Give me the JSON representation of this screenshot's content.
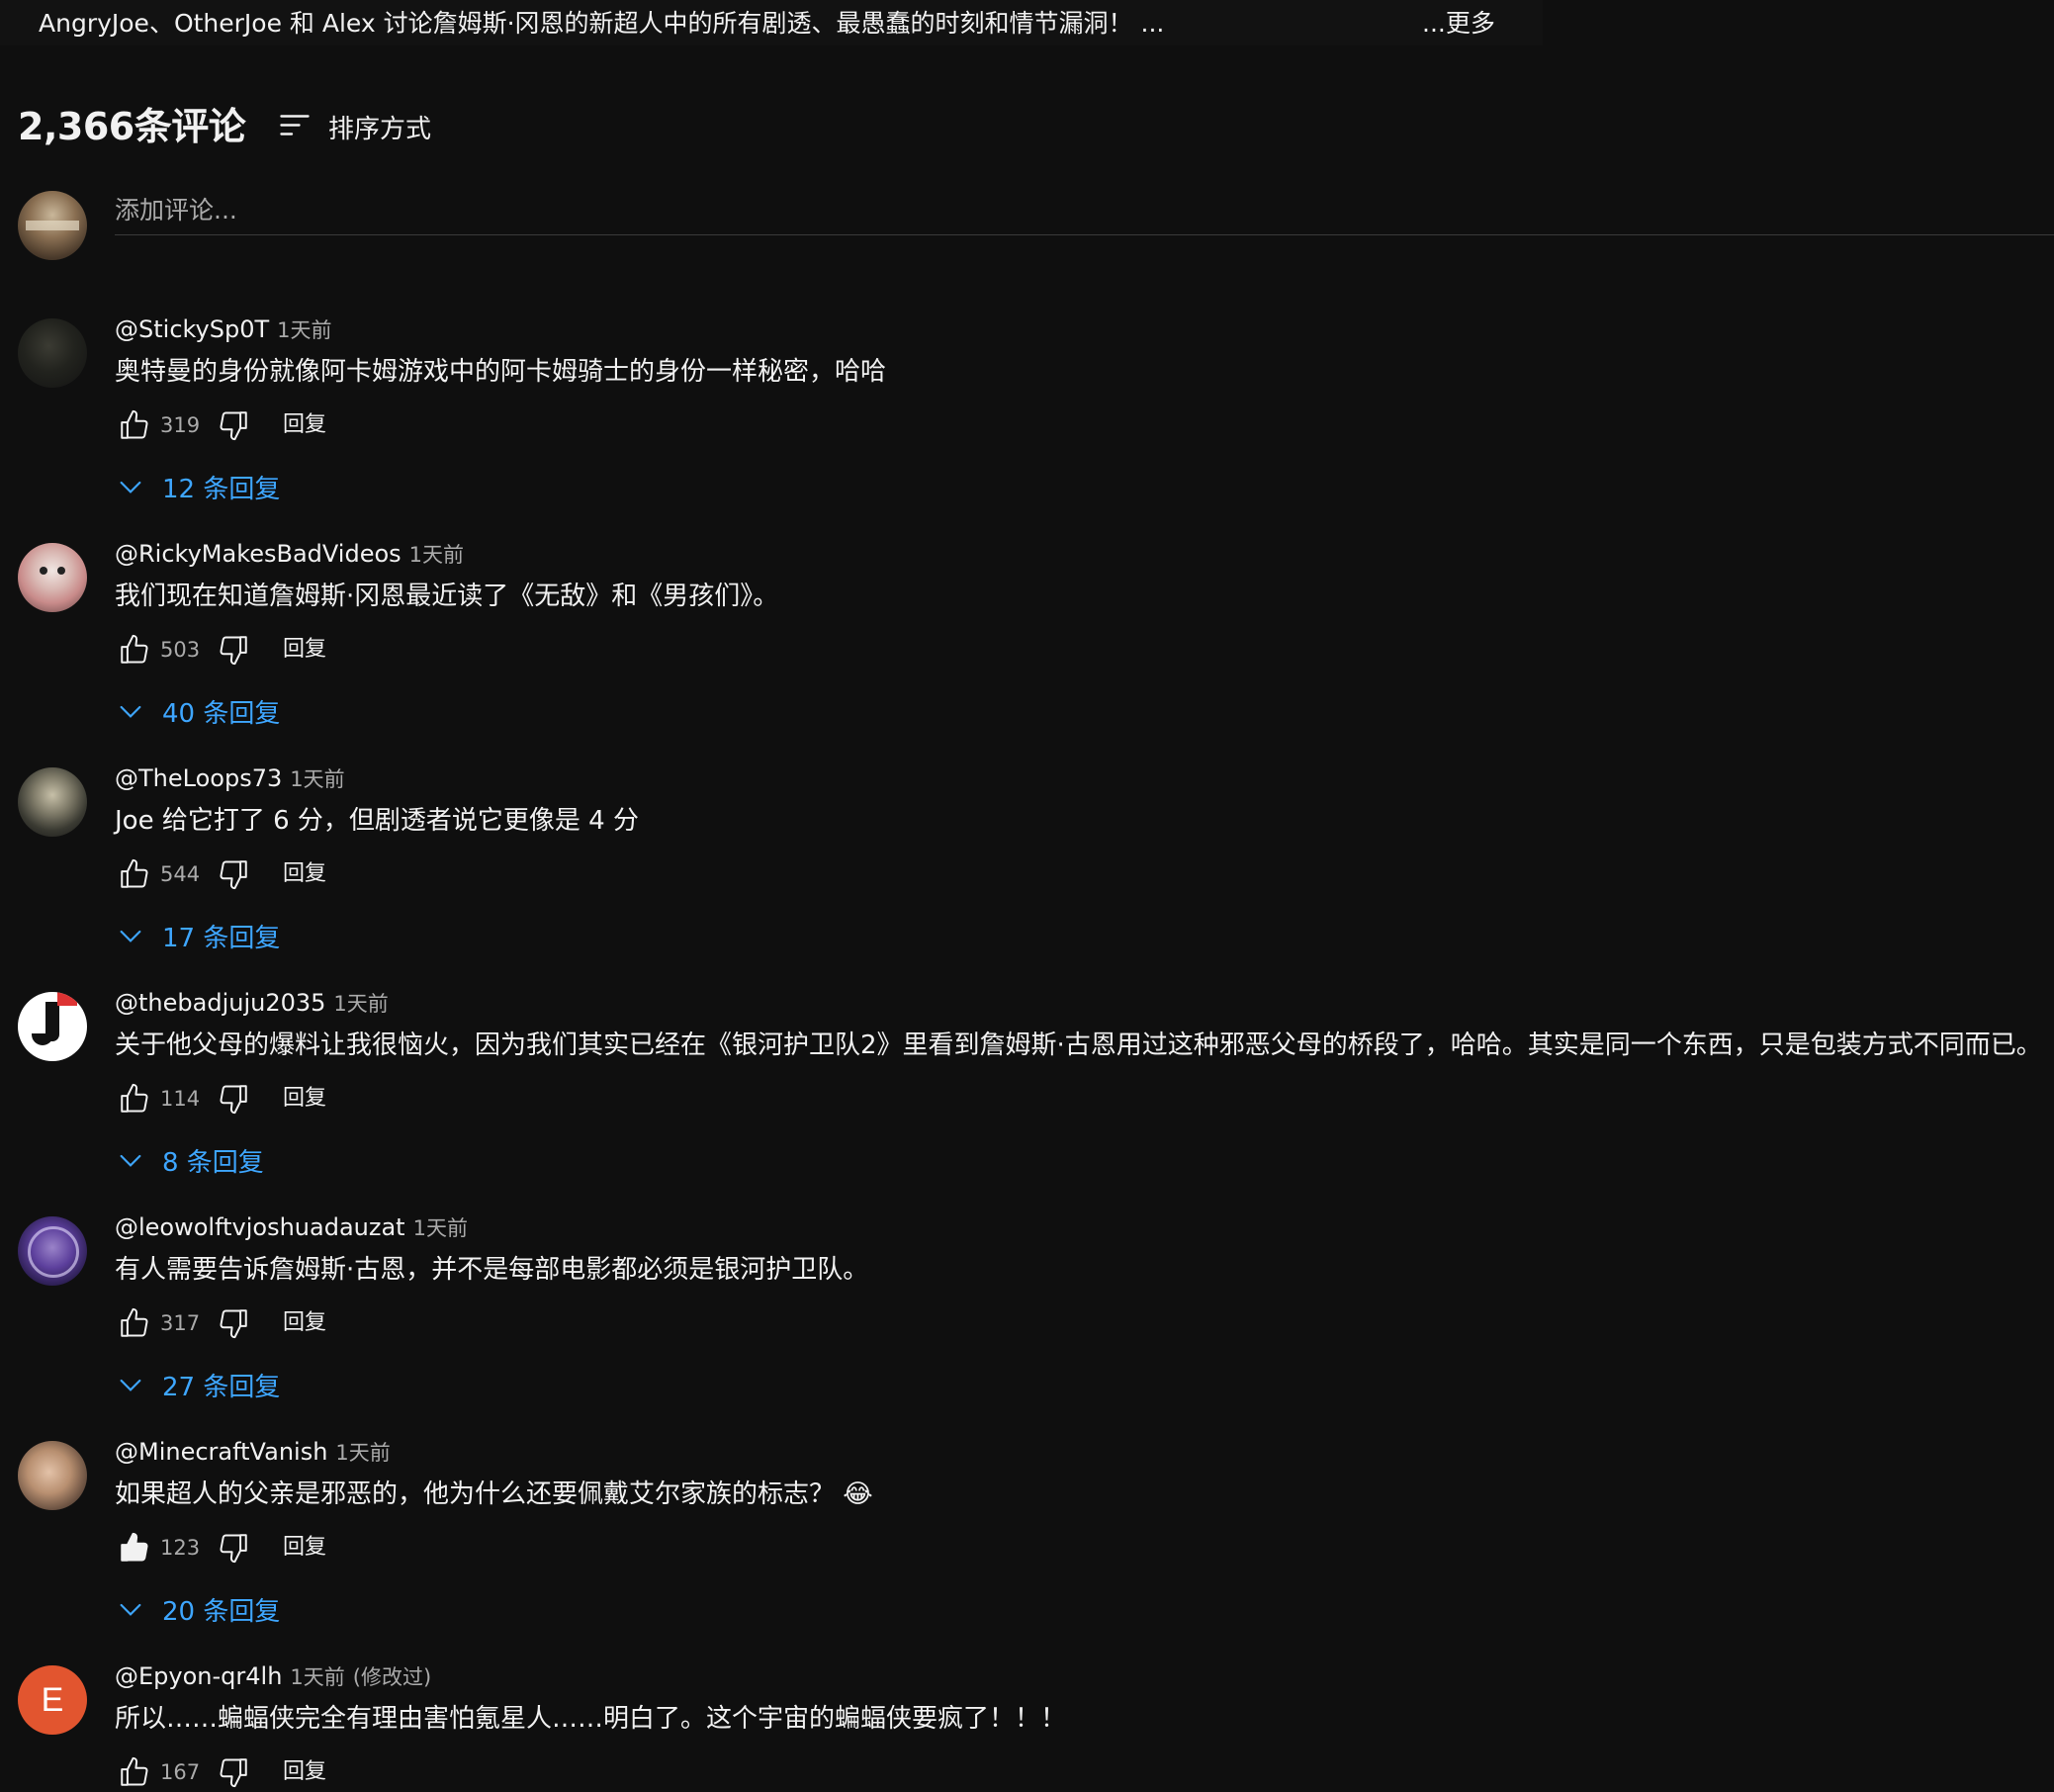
{
  "description": {
    "text": "AngryJoe、OtherJoe 和 Alex 讨论詹姆斯·冈恩的新超人中的所有剧透、最愚蠢的时刻和情节漏洞！ ...",
    "more": "...更多"
  },
  "comments_header": {
    "count": "2,366条评论",
    "sort_label": "排序方式"
  },
  "add_comment": {
    "placeholder": "添加评论..."
  },
  "comments": [
    {
      "author": "@StickySp0T",
      "time": "1天前",
      "text": "奥特曼的身份就像阿卡姆游戏中的阿卡姆骑士的身份一样秘密，哈哈",
      "likes": "319",
      "reply_label": "回复",
      "replies": "12 条回复",
      "liked": false
    },
    {
      "author": "@RickyMakesBadVideos",
      "time": "1天前",
      "text": "我们现在知道詹姆斯·冈恩最近读了《无敌》和《男孩们》。",
      "likes": "503",
      "reply_label": "回复",
      "replies": "40 条回复",
      "liked": false
    },
    {
      "author": "@TheLoops73",
      "time": "1天前",
      "text": "Joe 给它打了 6 分，但剧透者说它更像是 4 分",
      "likes": "544",
      "reply_label": "回复",
      "replies": "17 条回复",
      "liked": false
    },
    {
      "author": "@thebadjuju2035",
      "time": "1天前",
      "text": "关于他父母的爆料让我很恼火，因为我们其实已经在《银河护卫队2》里看到詹姆斯·古恩用过这种邪恶父母的桥段了，哈哈。其实是同一个东西，只是包装方式不同而已。",
      "likes": "114",
      "reply_label": "回复",
      "replies": "8 条回复",
      "liked": false
    },
    {
      "author": "@leowolftvjoshuadauzat",
      "time": "1天前",
      "text": "有人需要告诉詹姆斯·古恩，并不是每部电影都必须是银河护卫队。",
      "likes": "317",
      "reply_label": "回复",
      "replies": "27 条回复",
      "liked": false
    },
    {
      "author": "@MinecraftVanish",
      "time": "1天前",
      "text": "如果超人的父亲是邪恶的，他为什么还要佩戴艾尔家族的标志？ 😂",
      "likes": "123",
      "reply_label": "回复",
      "replies": "20 条回复",
      "liked": true
    },
    {
      "author": "@Epyon-qr4lh",
      "time": "1天前",
      "edited": "(修改过)",
      "avatar_letter": "E",
      "text": "所以……蝙蝠侠完全有理由害怕氪星人……明白了。这个宇宙的蝙蝠侠要疯了！！！",
      "likes": "167",
      "reply_label": "回复",
      "liked": false
    }
  ],
  "colors": {
    "background": "#0f0f0f",
    "link_blue": "#3ea6ff",
    "secondary_text": "#aaaaaa",
    "avatar_e": "#e2552f"
  }
}
